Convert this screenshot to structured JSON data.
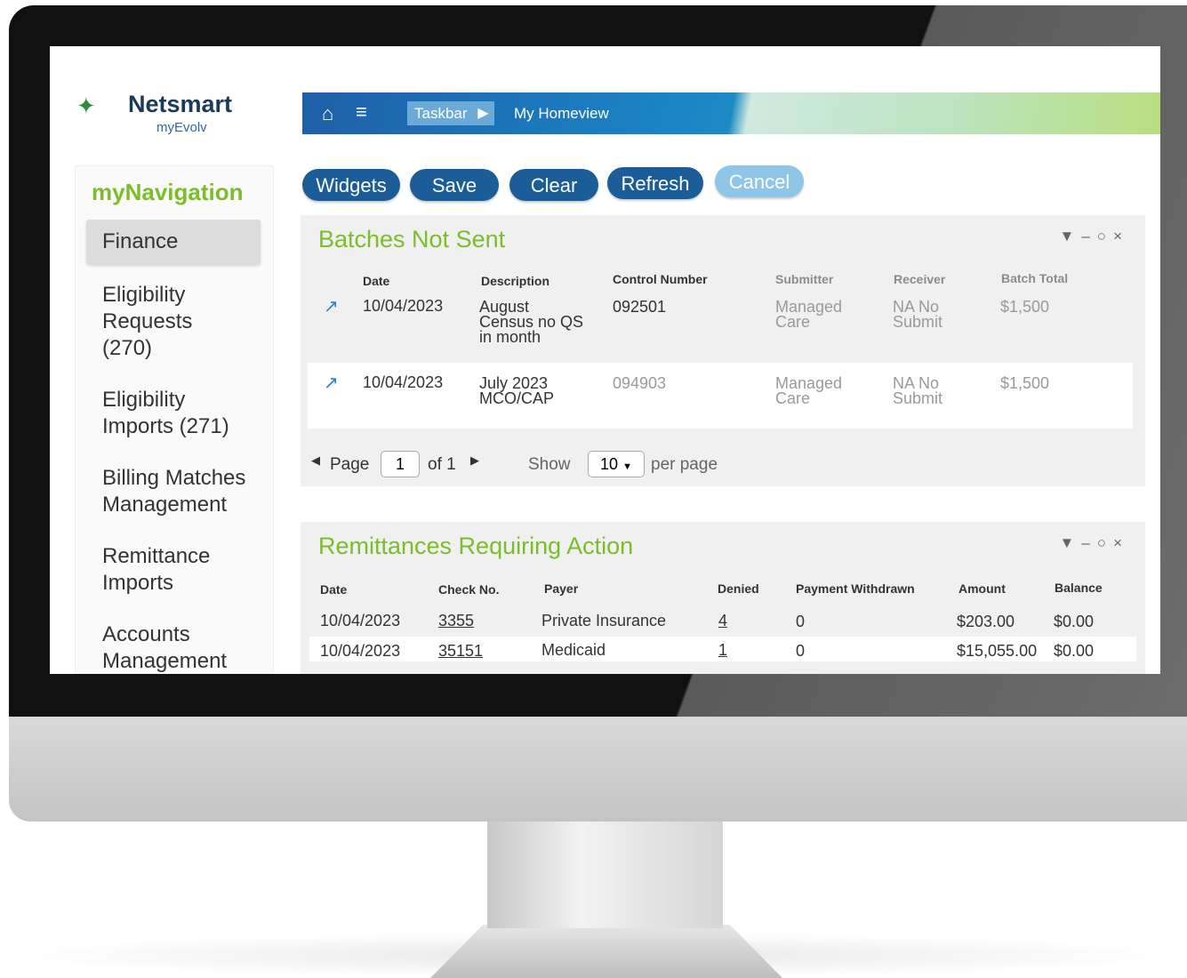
{
  "logo": {
    "name": "Netsmart",
    "sub": "myEvolv",
    "sub_mark": "'"
  },
  "nav": {
    "title": "myNavigation",
    "items": [
      {
        "label": "Finance"
      },
      {
        "label": "Eligibility Requests (270)"
      },
      {
        "label": "Eligibility Imports (271)"
      },
      {
        "label": "Billing Matches Management"
      },
      {
        "label": "Remittance Imports"
      },
      {
        "label": "Accounts Management"
      }
    ]
  },
  "topbar": {
    "crumb1": "Taskbar",
    "crumb2": "My Homeview"
  },
  "toolbar": {
    "widgets": "Widgets",
    "save": "Save",
    "clear": "Clear",
    "refresh": "Refresh",
    "cancel": "Cancel"
  },
  "batches": {
    "title": "Batches Not Sent",
    "headers": {
      "date": "Date",
      "description": "Description",
      "control": "Control Number",
      "submitter": "Submitter",
      "receiver": "Receiver",
      "total": "Batch Total"
    },
    "rows": [
      {
        "date": "10/04/2023",
        "description": "August Census no QS in month",
        "control": "092501",
        "submitter": "Managed Care",
        "receiver": "NA No Submit",
        "total": "$1,500"
      },
      {
        "date": "10/04/2023",
        "description": "July 2023 MCO/CAP",
        "control": "094903",
        "submitter": "Managed Care",
        "receiver": "NA No Submit",
        "total": "$1,500"
      }
    ],
    "pager": {
      "page_label": "Page",
      "page": "1",
      "of": "of 1",
      "show": "Show",
      "per": "10",
      "per_page": "per page"
    }
  },
  "remittances": {
    "title": "Remittances Requiring Action",
    "headers": {
      "date": "Date",
      "check": "Check No.",
      "payer": "Payer",
      "denied": "Denied",
      "withdrawn": "Payment Withdrawn",
      "amount": "Amount",
      "balance": "Balance"
    },
    "rows": [
      {
        "date": "10/04/2023",
        "check": "3355",
        "payer": "Private Insurance",
        "denied": "4",
        "withdrawn": "0",
        "amount": "$203.00",
        "balance": "$0.00"
      },
      {
        "date": "10/04/2023",
        "check": "35151",
        "payer": "Medicaid",
        "denied": "1",
        "withdrawn": "0",
        "amount": "$15,055.00",
        "balance": "$0.00"
      }
    ]
  }
}
